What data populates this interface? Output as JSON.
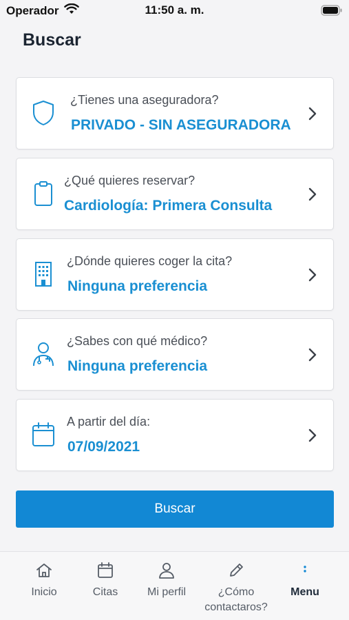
{
  "status_bar": {
    "carrier": "Operador",
    "time": "11:50 a. m."
  },
  "page": {
    "title": "Buscar"
  },
  "cards": [
    {
      "icon": "shield-icon",
      "label": "¿Tienes una aseguradora?",
      "value": "PRIVADO - SIN ASEGURADORA"
    },
    {
      "icon": "clipboard-icon",
      "label": "¿Qué quieres reservar?",
      "value": "Cardiología: Primera Consulta"
    },
    {
      "icon": "building-icon",
      "label": "¿Dónde quieres coger la cita?",
      "value": "Ninguna preferencia"
    },
    {
      "icon": "doctor-icon",
      "label": "¿Sabes con qué médico?",
      "value": "Ninguna preferencia"
    },
    {
      "icon": "calendar-icon",
      "label": "A partir del día:",
      "value": "07/09/2021"
    }
  ],
  "search_button": {
    "label": "Buscar"
  },
  "tab_bar": {
    "items": [
      {
        "icon": "home-icon",
        "label": "Inicio"
      },
      {
        "icon": "calendar-icon",
        "label": "Citas"
      },
      {
        "icon": "user-icon",
        "label": "Mi perfil"
      },
      {
        "icon": "pencil-icon",
        "label": "¿Cómo contactaros?"
      },
      {
        "icon": "more-vertical-icon",
        "label": "Menu",
        "active": true
      }
    ]
  },
  "colors": {
    "accent": "#1a8fd2",
    "button": "#1288d4",
    "background": "#f4f4f6"
  }
}
